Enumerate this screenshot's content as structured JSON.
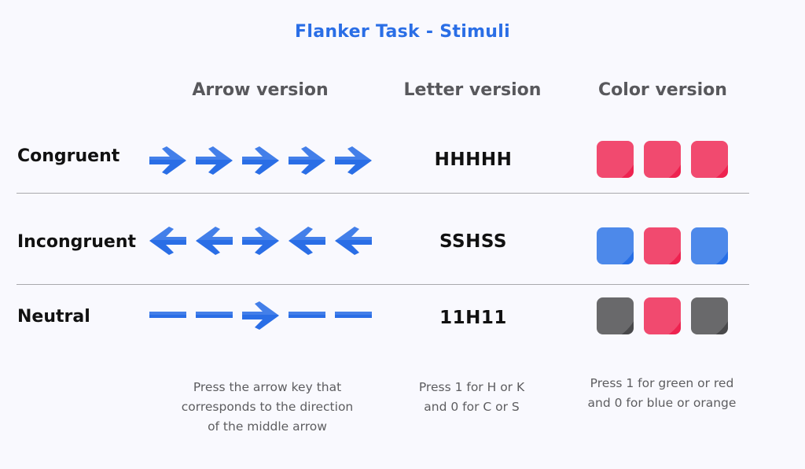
{
  "title": "Flanker Task - Stimuli",
  "colors": {
    "title": "#2a6ee6",
    "arrow": "#2a6ee6",
    "red": "#ee2350",
    "blue": "#276fe6",
    "gray": "#49494b"
  },
  "columns": [
    {
      "label": "Arrow version"
    },
    {
      "label": "Letter version"
    },
    {
      "label": "Color version"
    }
  ],
  "rows": [
    {
      "label": "Congruent",
      "arrows": [
        "right-arrow",
        "right-arrow",
        "right-arrow",
        "right-arrow",
        "right-arrow"
      ],
      "letters": "HHHHH",
      "swatches": [
        "red",
        "red",
        "red"
      ]
    },
    {
      "label": "Incongruent",
      "arrows": [
        "left-arrow",
        "left-arrow",
        "right-arrow",
        "left-arrow",
        "left-arrow"
      ],
      "letters": "SSHSS",
      "swatches": [
        "blue",
        "red",
        "blue"
      ]
    },
    {
      "label": "Neutral",
      "arrows": [
        "dash",
        "dash",
        "right-arrow",
        "dash",
        "dash"
      ],
      "letters": "11H11",
      "swatches": [
        "gray",
        "red",
        "gray"
      ]
    }
  ],
  "instructions": [
    {
      "lines": [
        "Press the arrow key that",
        "corresponds to the direction",
        "of the middle arrow"
      ]
    },
    {
      "lines": [
        "Press 1 for H or K",
        "and 0 for C or S"
      ]
    },
    {
      "lines": [
        "Press 1 for green or red",
        "and 0 for blue or orange"
      ]
    }
  ]
}
